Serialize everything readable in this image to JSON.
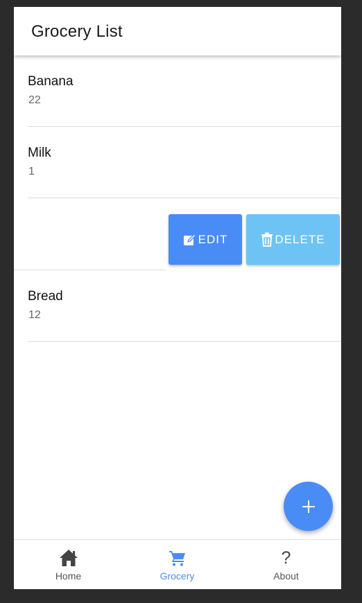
{
  "header": {
    "title": "Grocery List"
  },
  "items": [
    {
      "name": "Banana",
      "qty": "22"
    },
    {
      "name": "Milk",
      "qty": "1"
    },
    {
      "name": "Bread",
      "qty": "12"
    }
  ],
  "swipe_actions": {
    "edit_label": "EDIT",
    "delete_label": "DELETE",
    "edit_color": "#4a8cf6",
    "delete_color": "#6ec3f5",
    "edit_icon": "edit-icon",
    "delete_icon": "trash-icon"
  },
  "fab": {
    "icon": "plus-icon",
    "color": "#4a8cf6"
  },
  "bottom_nav": {
    "active": "Grocery",
    "active_color": "#4a8cf6",
    "items": [
      {
        "label": "Home",
        "icon": "home-icon"
      },
      {
        "label": "Grocery",
        "icon": "cart-icon"
      },
      {
        "label": "About",
        "icon": "question-icon",
        "glyph": "?"
      }
    ]
  }
}
